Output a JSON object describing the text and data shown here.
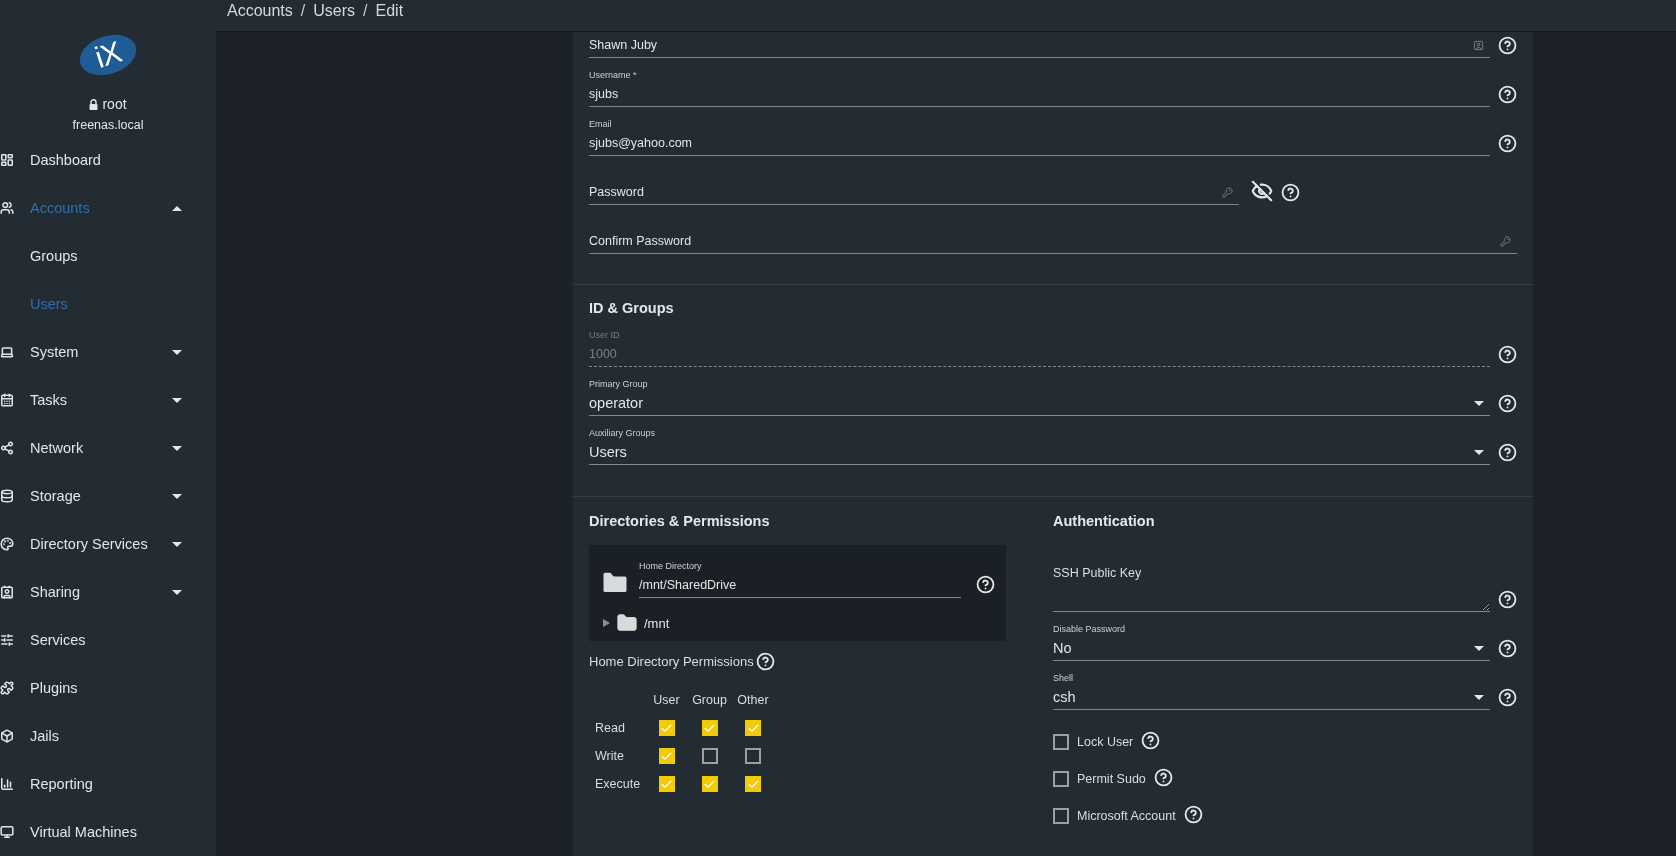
{
  "breadcrumb": [
    {
      "kind": "link",
      "text": "Accounts"
    },
    {
      "kind": "separator",
      "text": "/"
    },
    {
      "kind": "link",
      "text": "Users"
    },
    {
      "kind": "separator",
      "text": "/"
    },
    {
      "kind": "link",
      "text": "Edit"
    }
  ],
  "sidebar": {
    "logo": "iX",
    "user": "root",
    "host": "freenas.local",
    "items": [
      {
        "label": "Dashboard",
        "kind": "link",
        "selected": false
      },
      {
        "label": "Accounts",
        "kind": "group",
        "selected": true,
        "expanded": true,
        "children": [
          {
            "label": "Groups",
            "selected": false
          },
          {
            "label": "Users",
            "selected": true
          }
        ]
      },
      {
        "label": "System",
        "kind": "group",
        "selected": false,
        "expanded": false
      },
      {
        "label": "Tasks",
        "kind": "group",
        "selected": false,
        "expanded": false
      },
      {
        "label": "Network",
        "kind": "group",
        "selected": false,
        "expanded": false
      },
      {
        "label": "Storage",
        "kind": "group",
        "selected": false,
        "expanded": false
      },
      {
        "label": "Directory Services",
        "kind": "group",
        "selected": false,
        "expanded": false
      },
      {
        "label": "Sharing",
        "kind": "group",
        "selected": false,
        "expanded": false
      },
      {
        "label": "Services",
        "kind": "link",
        "selected": false
      },
      {
        "label": "Plugins",
        "kind": "link",
        "selected": false
      },
      {
        "label": "Jails",
        "kind": "link",
        "selected": false
      },
      {
        "label": "Reporting",
        "kind": "link",
        "selected": false
      },
      {
        "label": "Virtual Machines",
        "kind": "link",
        "selected": false
      }
    ]
  },
  "identity_fields": [
    {
      "kind": "fullname",
      "value": "Shawn Juby"
    },
    {
      "kind": "text",
      "label": "Username *",
      "value": "sjubs"
    },
    {
      "kind": "text",
      "label": "Email",
      "value": "sjubs@yahoo.com"
    },
    {
      "kind": "password",
      "placeholder": "Password",
      "visible": false
    },
    {
      "kind": "confirm",
      "placeholder": "Confirm Password"
    }
  ],
  "id_groups": {
    "title": "ID & Groups",
    "fields": [
      {
        "kind": "text",
        "label": "User ID",
        "value": "1000",
        "disabled": true
      },
      {
        "kind": "select",
        "label": "Primary Group",
        "value": "operator",
        "disabled": false
      },
      {
        "kind": "select",
        "label": "Auxiliary Groups",
        "value": "Users",
        "disabled": false
      }
    ]
  },
  "directories": {
    "title": "Directories & Permissions",
    "home_directory": {
      "label": "Home Directory",
      "value": "/mnt/SharedDrive",
      "tree": [
        {
          "label": "/mnt",
          "expanded": false
        }
      ]
    },
    "permissions": {
      "title": "Home Directory Permissions",
      "columns": [
        "User",
        "Group",
        "Other"
      ],
      "rows": [
        {
          "label": "Read",
          "checked": [
            true,
            true,
            true
          ]
        },
        {
          "label": "Write",
          "checked": [
            true,
            false,
            false
          ]
        },
        {
          "label": "Execute",
          "checked": [
            true,
            true,
            true
          ]
        }
      ]
    }
  },
  "authentication": {
    "title": "Authentication",
    "ssh_key": {
      "placeholder": "SSH Public Key"
    },
    "fields": [
      {
        "kind": "select",
        "label": "Disable Password",
        "value": "No"
      },
      {
        "kind": "select",
        "label": "Shell",
        "value": "csh"
      }
    ],
    "checkboxes": [
      {
        "label": "Lock User",
        "checked": false
      },
      {
        "label": "Permit Sudo",
        "checked": false
      },
      {
        "label": "Microsoft Account",
        "checked": false
      }
    ]
  }
}
